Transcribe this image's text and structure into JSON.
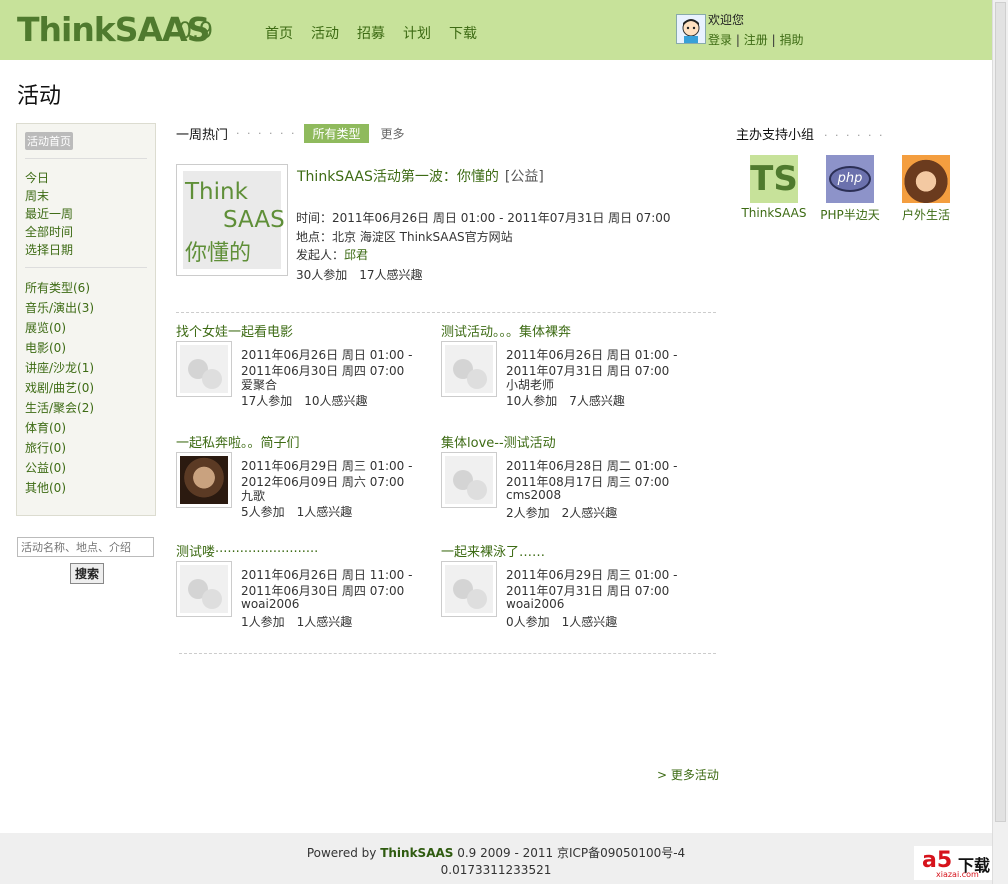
{
  "header": {
    "logo": "ThinkSAAS",
    "version": "0.9",
    "nav": [
      "首页",
      "活动",
      "招募",
      "计划",
      "下载"
    ],
    "welcome": "欢迎您",
    "login": "登录",
    "register": "注册",
    "donate": "捐助",
    "separator": "|"
  },
  "page_title": "活动",
  "sidebar": {
    "home_tag": "活动首页",
    "time_filters": [
      "今日",
      "周末",
      "最近一周",
      "全部时间",
      "选择日期"
    ],
    "types": [
      "所有类型(6)",
      "音乐/演出(3)",
      "展览(0)",
      "电影(0)",
      "讲座/沙龙(1)",
      "戏剧/曲艺(0)",
      "生活/聚会(2)",
      "体育(0)",
      "旅行(0)",
      "公益(0)",
      "其他(0)"
    ],
    "search_placeholder": "活动名称、地点、介绍",
    "search_button": "搜索"
  },
  "hot": {
    "heading": "一周热门",
    "dots": "· · · · · ·",
    "all_types": "所有类型",
    "more": "更多"
  },
  "feature": {
    "thumb_l1": "Think",
    "thumb_l2": "SAAS",
    "thumb_l3": "你懂的",
    "title": "ThinkSAAS活动第一波：你懂的",
    "tag": "[公益]",
    "time": "时间：2011年06月26日 周日 01:00 - 2011年07月31日 周日 07:00",
    "place": "地点：北京 海淀区 ThinkSAAS官方网站",
    "organizer_label": "发起人：",
    "organizer": "邱君",
    "stats": "30人参加　17人感兴趣"
  },
  "events": [
    {
      "title": "找个女娃一起看电影",
      "l1": "2011年06月26日 周日 01:00 -",
      "l2": "2011年06月30日 周四 07:00",
      "user": "爱聚合",
      "stats": "17人参加　10人感兴趣",
      "img": "placeholder"
    },
    {
      "title": "测试活动。。。集体裸奔",
      "l1": "2011年06月26日 周日 01:00 -",
      "l2": "2011年07月31日 周日 07:00",
      "user": "小胡老师",
      "stats": "10人参加　7人感兴趣",
      "img": "placeholder"
    },
    {
      "title": "一起私奔啦。。简子们",
      "l1": "2011年06月29日 周三 01:00 -",
      "l2": "2012年06月09日 周六 07:00",
      "user": "九歌",
      "stats": "5人参加　1人感兴趣",
      "img": "face"
    },
    {
      "title": "集体love--测试活动",
      "l1": "2011年06月28日 周二 01:00 -",
      "l2": "2011年08月17日 周三 07:00",
      "user": "cms2008",
      "stats": "2人参加　2人感兴趣",
      "img": "placeholder"
    },
    {
      "title": "测试喽·························",
      "l1": "2011年06月26日 周日 11:00 -",
      "l2": "2011年06月30日 周四 07:00",
      "user": "woai2006",
      "stats": "1人参加　1人感兴趣",
      "img": "placeholder"
    },
    {
      "title": "一起来裸泳了……",
      "l1": "2011年06月29日 周三 01:00 -",
      "l2": "2011年07月31日 周日 07:00",
      "user": "woai2006",
      "stats": "0人参加　1人感兴趣",
      "img": "placeholder"
    }
  ],
  "more_events": "> 更多活动",
  "groups": {
    "heading": "主办支持小组",
    "dots": "· · · · · ·",
    "items": [
      {
        "logo": "TS",
        "name": "ThinkSAAS"
      },
      {
        "logo": "php",
        "name": "PHP半边天"
      },
      {
        "name": "户外生活"
      }
    ]
  },
  "footer": {
    "prefix": "Powered by ",
    "brand": "ThinkSAAS",
    "suffix": " 0.9 2009 - 2011 京ICP备09050100号-4",
    "time": "0.0173311233521"
  },
  "watermark": {
    "a5": "a5",
    "dl": "下载",
    "url": "xiazai.com"
  },
  "colors": {
    "header_bg": "#c7e29a",
    "accent": "#3d6b14",
    "badge": "#8fba5d"
  }
}
